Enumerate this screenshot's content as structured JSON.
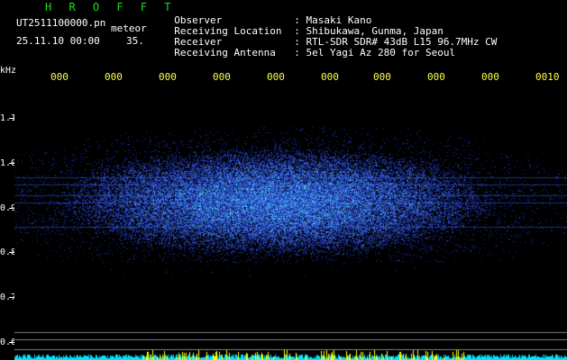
{
  "header": {
    "station_title": "H R O F F T",
    "filename": "UT2511100000.pn",
    "type_label": "meteor",
    "datetime": "25.11.10 00:00",
    "count": "35."
  },
  "info": [
    {
      "key": "Observer",
      "value": ": Masaki Kano"
    },
    {
      "key": "Receiving Location",
      "value": ": Shibukawa, Gunma, Japan"
    },
    {
      "key": "Receiver",
      "value": ": RTL-SDR SDR# 43dB L15 96.7MHz CW"
    },
    {
      "key": "Receiving Antenna",
      "value": ": 5el Yagi Az 280 for Seoul"
    }
  ],
  "axes": {
    "y_unit": "kHz",
    "y_ticks": [
      "1.1",
      "1.0",
      "0.9",
      "0.8",
      "0.7",
      "0.6"
    ],
    "x_ticks": [
      "000",
      "000",
      "000",
      "000",
      "000",
      "000",
      "000",
      "000",
      "000",
      "0010"
    ]
  },
  "colors": {
    "background": "#000000",
    "title": "#19e019",
    "text": "#ffffff",
    "x_ticks": "#ffff44",
    "signal_low": "#1030c0",
    "signal_high": "#40ffff",
    "baseline": "#00e5ff",
    "meteor_spikes": "#ffff00"
  }
}
